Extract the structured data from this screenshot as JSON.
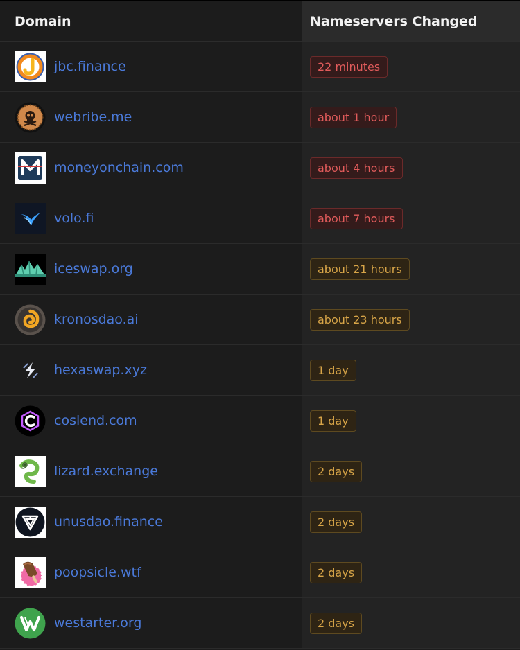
{
  "header": {
    "domain_label": "Domain",
    "ns_label": "Nameservers Changed"
  },
  "colors": {
    "link": "#4a79d8",
    "recent_badge": "#e15b5b",
    "older_badge": "#d8a548"
  },
  "rows": [
    {
      "domain": "jbc.finance",
      "changed": "22 minutes",
      "status": "red",
      "icon": "jbc-logo-icon"
    },
    {
      "domain": "webribe.me",
      "changed": "about 1 hour",
      "status": "red",
      "icon": "skull-logo-icon"
    },
    {
      "domain": "moneyonchain.com",
      "changed": "about 4 hours",
      "status": "red",
      "icon": "m-logo-icon"
    },
    {
      "domain": "volo.fi",
      "changed": "about 7 hours",
      "status": "red",
      "icon": "volo-logo-icon"
    },
    {
      "domain": "iceswap.org",
      "changed": "about 21 hours",
      "status": "amber",
      "icon": "mountain-logo-icon"
    },
    {
      "domain": "kronosdao.ai",
      "changed": "about 23 hours",
      "status": "amber",
      "icon": "swirl-logo-icon"
    },
    {
      "domain": "hexaswap.xyz",
      "changed": "1 day",
      "status": "amber",
      "icon": "bolt-logo-icon"
    },
    {
      "domain": "coslend.com",
      "changed": "1 day",
      "status": "amber",
      "icon": "c-logo-icon"
    },
    {
      "domain": "lizard.exchange",
      "changed": "2 days",
      "status": "amber",
      "icon": "lizard-logo-icon"
    },
    {
      "domain": "unusdao.finance",
      "changed": "2 days",
      "status": "amber",
      "icon": "shield-logo-icon"
    },
    {
      "domain": "poopsicle.wtf",
      "changed": "2 days",
      "status": "amber",
      "icon": "popsicle-logo-icon"
    },
    {
      "domain": "westarter.org",
      "changed": "2 days",
      "status": "amber",
      "icon": "w-logo-icon"
    }
  ]
}
